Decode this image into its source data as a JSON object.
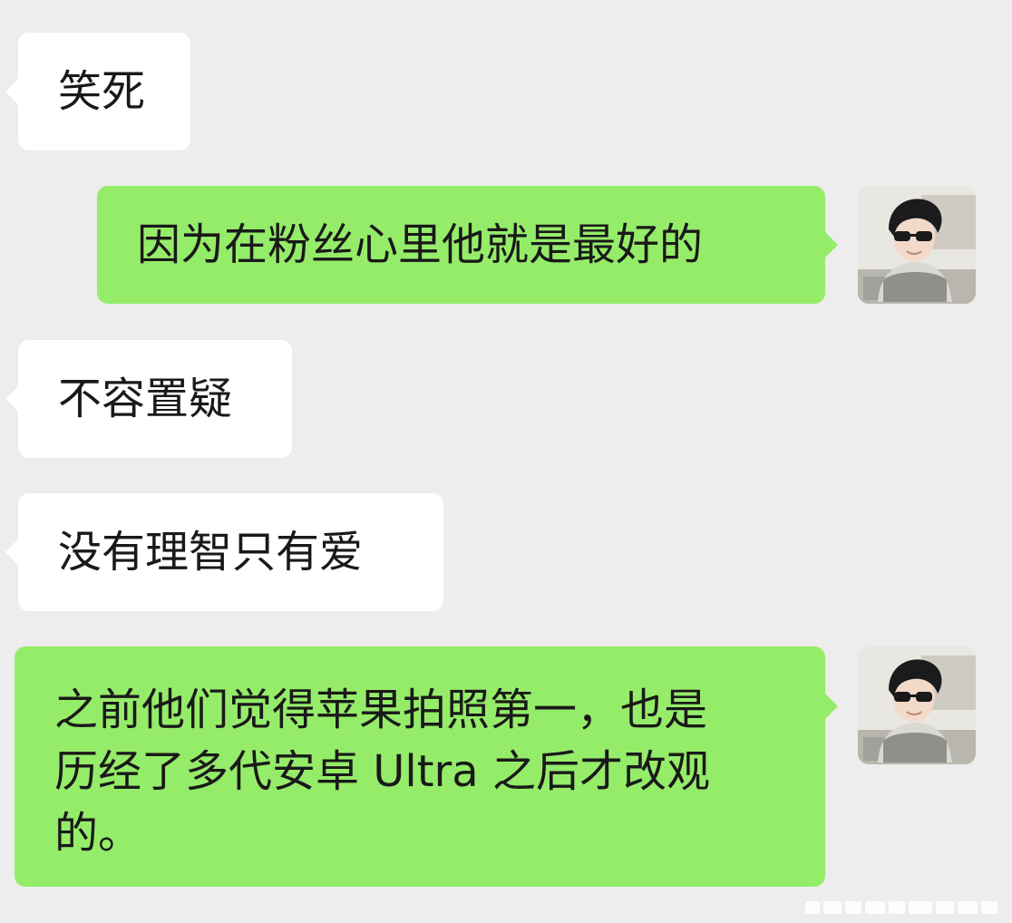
{
  "conversation": {
    "messages": [
      {
        "direction": "incoming",
        "text": "笑死"
      },
      {
        "direction": "outgoing",
        "text": "因为在粉丝心里他就是最好的"
      },
      {
        "direction": "incoming",
        "text": "不容置疑"
      },
      {
        "direction": "incoming",
        "text": "没有理智只有爱"
      },
      {
        "direction": "outgoing",
        "text": "之前他们觉得苹果拍照第一，也是\n历经了多代安卓 Ultra 之后才改观\n的。"
      }
    ]
  },
  "colors": {
    "background": "#ededed",
    "incoming_bubble": "#ffffff",
    "outgoing_bubble": "#95ec69",
    "text": "#191919"
  },
  "icons": {
    "avatar": "user-avatar-photo"
  }
}
